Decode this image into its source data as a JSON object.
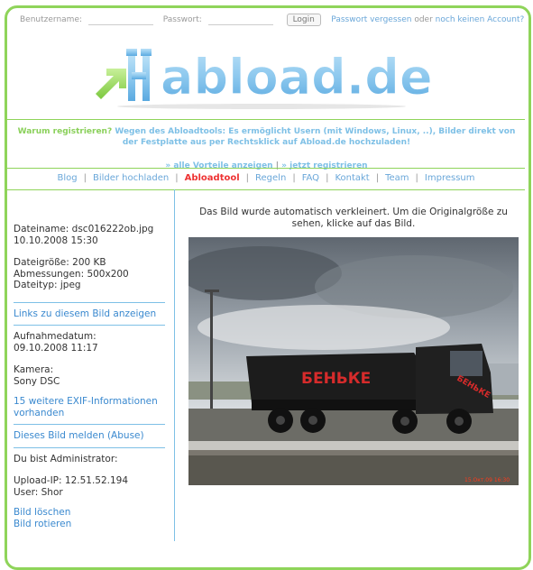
{
  "login": {
    "username_label": "Benutzername:",
    "password_label": "Passwort:",
    "login_button": "Login",
    "forgot_link": "Passwort vergessen",
    "or_text": "oder",
    "no_account_link": "noch keinen Account?"
  },
  "logo": {
    "text": "abload.de"
  },
  "promo": {
    "question": "Warum registrieren?",
    "text": "Wegen des Abloadtools: Es ermöglicht Usern (mit Windows, Linux, ..), Bilder direkt von der Festplatte aus per Rechtsklick auf Abload.de hochzuladen!",
    "link_advantages": "» alle Vorteile anzeigen",
    "link_separator": "|",
    "link_register": "» jetzt registrieren"
  },
  "nav": {
    "items": [
      "Blog",
      "Bilder hochladen",
      "Abloadtool",
      "Regeln",
      "FAQ",
      "Kontakt",
      "Team",
      "Impressum"
    ],
    "active": "Abloadtool",
    "separator": "|"
  },
  "notice": "Das Bild wurde automatisch verkleinert. Um die Originalgröße zu sehen, klicke auf das Bild.",
  "file": {
    "name_line": "Dateiname: dsc016222ob.jpg",
    "date_line": "10.10.2008 15:30",
    "size_line": "Dateigröße: 200 KB",
    "dims_line": "Abmessungen: 500x200",
    "type_line": "Dateityp: jpeg",
    "links_label": "Links zu diesem Bild anzeigen",
    "capture_label": "Aufnahmedatum:",
    "capture_date": "09.10.2008 11:17",
    "camera_label": "Kamera:",
    "camera_value": "Sony DSC",
    "exif_label": "15 weitere EXIF-Informationen vorhanden",
    "report_label": "Dieses Bild melden (Abuse)",
    "admin_label": "Du bist Administrator:",
    "upload_ip": "Upload-IP: 12.51.52.194",
    "user": "User: Shor",
    "delete_label": "Bild löschen",
    "rotate_label": "Bild rotieren"
  },
  "photo": {
    "truck_text": "БЕНЬКЕ",
    "door_text": "БЕНЬКЕ",
    "timestamp": "15.Окт.09 16:30"
  },
  "colors": {
    "green": "#8fd45a",
    "blue": "#6aa7d9",
    "red": "#e33333"
  }
}
